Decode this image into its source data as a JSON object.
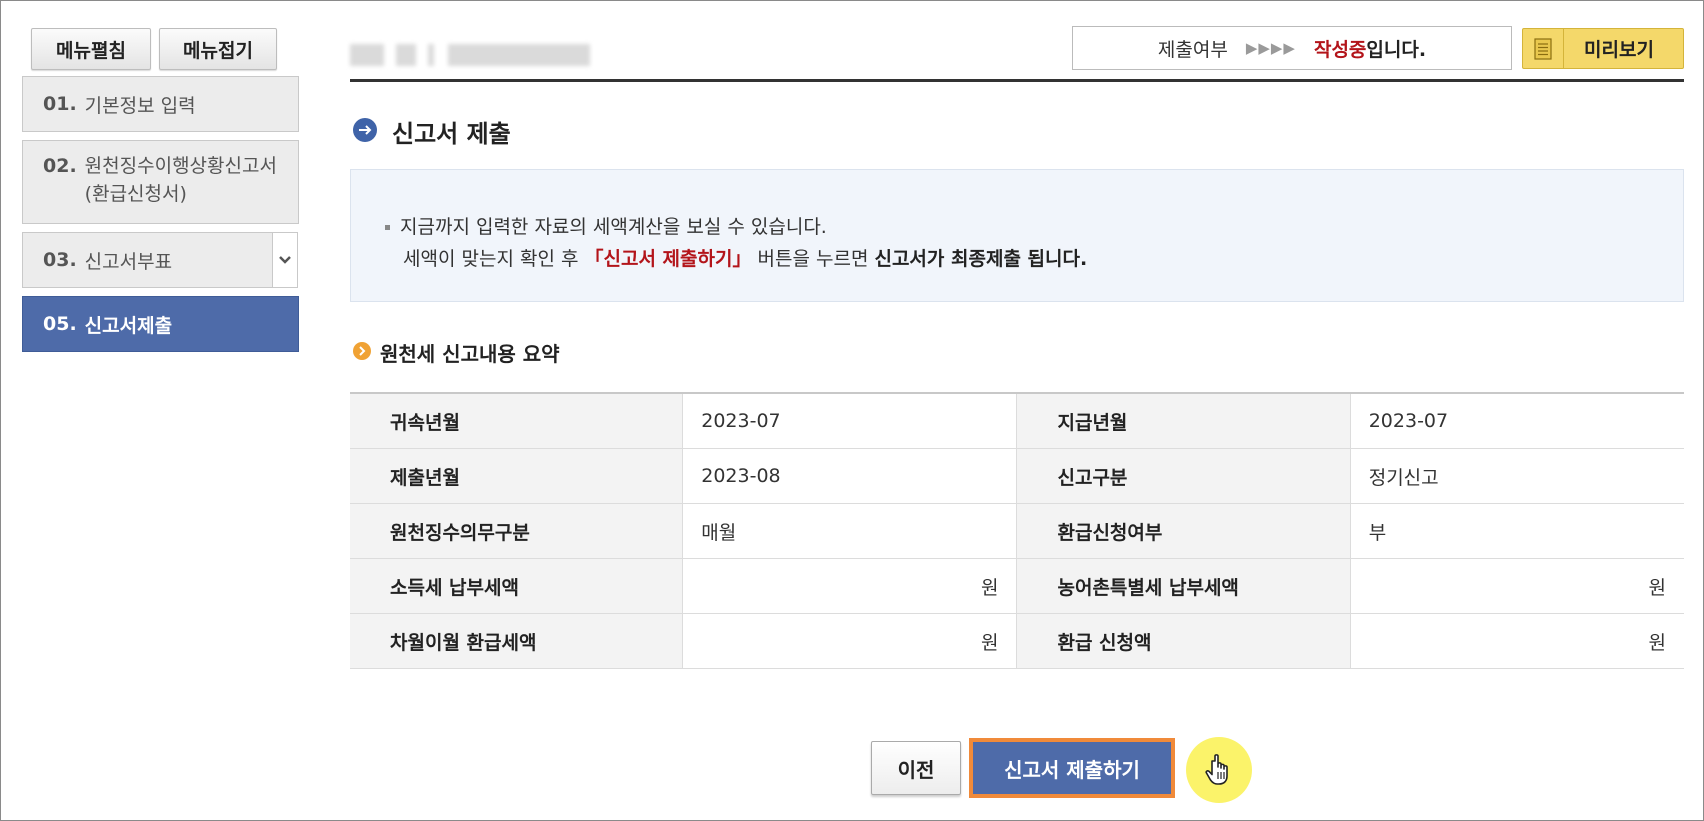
{
  "sidebar": {
    "expand_label": "메뉴펼침",
    "collapse_label": "메뉴접기",
    "items": [
      {
        "num": "01.",
        "label": "기본정보 입력"
      },
      {
        "num": "02.",
        "label": "원천징수이행상황신고서(환급신청서)"
      },
      {
        "num": "03.",
        "label": "신고서부표"
      },
      {
        "num": "05.",
        "label": "신고서제출"
      }
    ]
  },
  "header": {
    "status_label": "제출여부",
    "status_arrows": "▶▶▶▶",
    "status_value": "작성중",
    "status_suffix": "입니다.",
    "preview_label": "미리보기"
  },
  "section": {
    "title": "신고서 제출",
    "info_line1": "지금까지 입력한 자료의 세액계산을 보실 수 있습니다.",
    "info_line2_pre": "세액이 맞는지 확인 후 ",
    "info_line2_red": "「신고서 제출하기」",
    "info_line2_mid": " 버튼을 누르면 ",
    "info_line2_bold": "신고서가 최종제출 됩니다."
  },
  "summary": {
    "title": "원천세 신고내용 요약",
    "rows": [
      {
        "l1": "귀속년월",
        "v1": "2023-07",
        "l2": "지급년월",
        "v2": "2023-07"
      },
      {
        "l1": "제출년월",
        "v1": "2023-08",
        "l2": "신고구분",
        "v2": "정기신고"
      },
      {
        "l1": "원천징수의무구분",
        "v1": "매월",
        "l2": "환급신청여부",
        "v2": "부"
      },
      {
        "l1": "소득세 납부세액",
        "v1": "원",
        "l2": "농어촌특별세 납부세액",
        "v2": "원"
      },
      {
        "l1": "차월이월 환급세액",
        "v1": "원",
        "l2": "환급 신청액",
        "v2": "원"
      }
    ]
  },
  "actions": {
    "prev_label": "이전",
    "submit_label": "신고서 제출하기"
  },
  "colors": {
    "primary": "#4e6ba9",
    "accent_red": "#b3141a",
    "highlight_orange": "#f08a3a",
    "preview_yellow": "#f4d86a",
    "cursor_yellow": "#fbf36a"
  }
}
